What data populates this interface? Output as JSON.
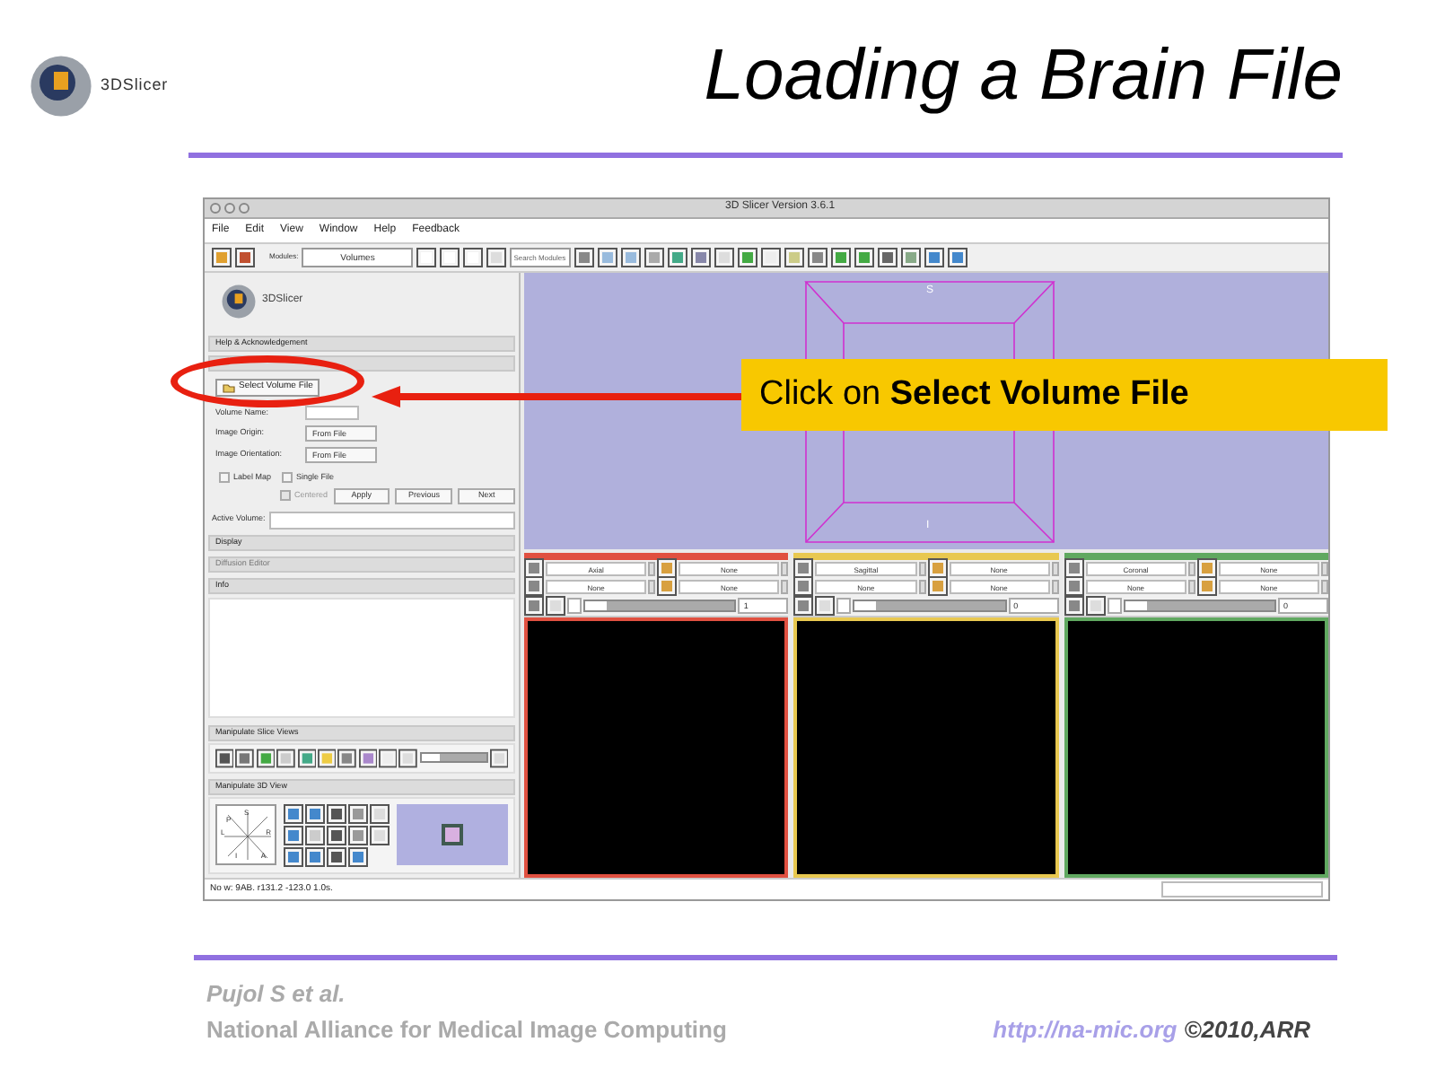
{
  "slide": {
    "logo_text": "3DSlicer",
    "title": "Loading a Brain File",
    "callout": "Click on **Select Volume File**",
    "footer": {
      "author": "Pujol S et al.",
      "organization": "National Alliance for Medical Image Computing",
      "url": "http://na-mic.org",
      "copyright": "©2010,ARR"
    }
  },
  "window": {
    "title": "3D Slicer Version 3.6.1"
  },
  "menu": [
    "File",
    "Edit",
    "View",
    "Window",
    "Help",
    "Feedback"
  ],
  "toolbar": {
    "module_label": "Modules:",
    "module": "Volumes",
    "search_placeholder": "Search Modules"
  },
  "left_panel": {
    "logo_text": "3DSlicer",
    "help_header": "Help & Acknowledgement",
    "select_button": "Select Volume File",
    "volume_name_label": "Volume Name:",
    "options": [
      {
        "label": "Image Origin:",
        "value": "From File"
      },
      {
        "label": "Image Orientation:",
        "value": "From File"
      }
    ],
    "checkboxes": [
      {
        "label": "Label Map",
        "checked": false,
        "disabled": false
      },
      {
        "label": "Single File",
        "checked": false,
        "disabled": false
      },
      {
        "label": "Centered",
        "checked": false,
        "disabled": true
      }
    ],
    "buttons": [
      "Apply",
      "Previous",
      "Next"
    ],
    "active_volume_label": "Active Volume:",
    "sections": [
      {
        "label": "Display",
        "disabled": false
      },
      {
        "label": "Diffusion Editor",
        "disabled": true
      },
      {
        "label": "Info",
        "disabled": false
      }
    ],
    "slice_header": "Manipulate Slice Views",
    "view3d_header": "Manipulate 3D View",
    "compass_labels": [
      "S",
      "P",
      "R",
      "L",
      "I",
      "A"
    ]
  },
  "view3d": {
    "top_label": "S",
    "bottom_label": "I"
  },
  "slice_views": [
    {
      "color": "#e05040",
      "orientation": "Axial",
      "background": "None",
      "foreground": "None",
      "label": "None",
      "value": "1"
    },
    {
      "color": "#e8c850",
      "orientation": "Sagittal",
      "background": "None",
      "foreground": "None",
      "label": "None",
      "value": "0"
    },
    {
      "color": "#60a860",
      "orientation": "Coronal",
      "background": "None",
      "foreground": "None",
      "label": "None",
      "value": "0"
    }
  ],
  "status_bar": {
    "text": "No w: 9AB. r131.2 -123.0 1.0s."
  }
}
